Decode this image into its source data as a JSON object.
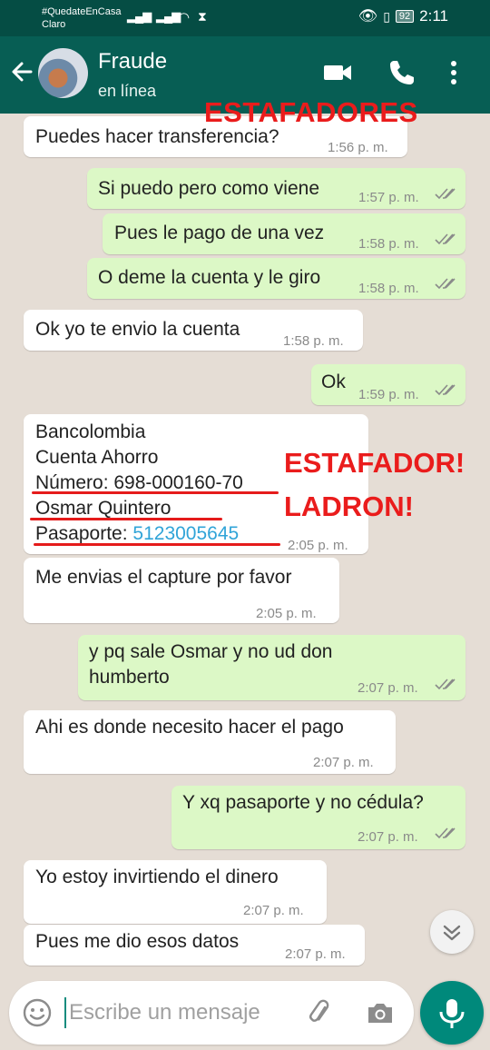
{
  "status_bar": {
    "carrier_tag": "#QuedateEnCasa",
    "carrier": "Claro",
    "battery": "92",
    "time": "2:11"
  },
  "header": {
    "contact_name": "Fraude",
    "presence": "en línea"
  },
  "annotations": {
    "title": "ESTAFADORES",
    "line1": "ESTAFADOR!",
    "line2": "LADRON!"
  },
  "messages": [
    {
      "dir": "in",
      "text": "Puedes hacer transferencia?",
      "time": "1:56 p. m."
    },
    {
      "dir": "out",
      "text": "Si puedo pero como viene",
      "time": "1:57 p. m.",
      "status": "read"
    },
    {
      "dir": "out",
      "text": "Pues le pago de una vez",
      "time": "1:58 p. m.",
      "status": "read"
    },
    {
      "dir": "out",
      "text": "O deme la cuenta y le giro",
      "time": "1:58 p. m.",
      "status": "read"
    },
    {
      "dir": "in",
      "text": "Ok yo te envio la cuenta",
      "time": "1:58 p. m."
    },
    {
      "dir": "out",
      "text": "Ok",
      "time": "1:59 p. m.",
      "status": "read"
    },
    {
      "dir": "in",
      "lines": [
        "Bancolombia",
        "Cuenta Ahorro",
        "Número: 698-000160-70",
        "Osmar Quintero"
      ],
      "passport_label": "Pasaporte: ",
      "passport_number": "5123005645",
      "time": "2:05 p. m."
    },
    {
      "dir": "in",
      "text": "Me envias el capture por favor",
      "time": "2:05 p. m."
    },
    {
      "dir": "out",
      "lines": [
        "y pq sale Osmar y no ud don",
        "humberto"
      ],
      "time": "2:07 p. m.",
      "status": "read"
    },
    {
      "dir": "in",
      "text": "Ahi es donde necesito hacer el pago",
      "time": "2:07 p. m."
    },
    {
      "dir": "out",
      "text": "Y xq pasaporte y no cédula?",
      "time": "2:07 p. m.",
      "status": "read"
    },
    {
      "dir": "in",
      "text": "Yo estoy invirtiendo el dinero",
      "time": "2:07 p. m."
    },
    {
      "dir": "in",
      "text": "Pues me dio esos datos",
      "time": "2:07 p. m."
    }
  ],
  "composer": {
    "placeholder": "Escribe un mensaje"
  },
  "icons": [
    "back-arrow-icon",
    "video-call-icon",
    "voice-call-icon",
    "more-options-icon",
    "double-check-icon",
    "scroll-down-icon",
    "emoji-icon",
    "attach-icon",
    "camera-icon",
    "mic-icon"
  ],
  "colors": {
    "header": "#075e54",
    "status_bar": "#054d44",
    "outgoing_bubble": "#dcf8c6",
    "incoming_bubble": "#ffffff",
    "annotation_red": "#ea1c1c",
    "link": "#30a4d8",
    "mic_button": "#00897b"
  }
}
